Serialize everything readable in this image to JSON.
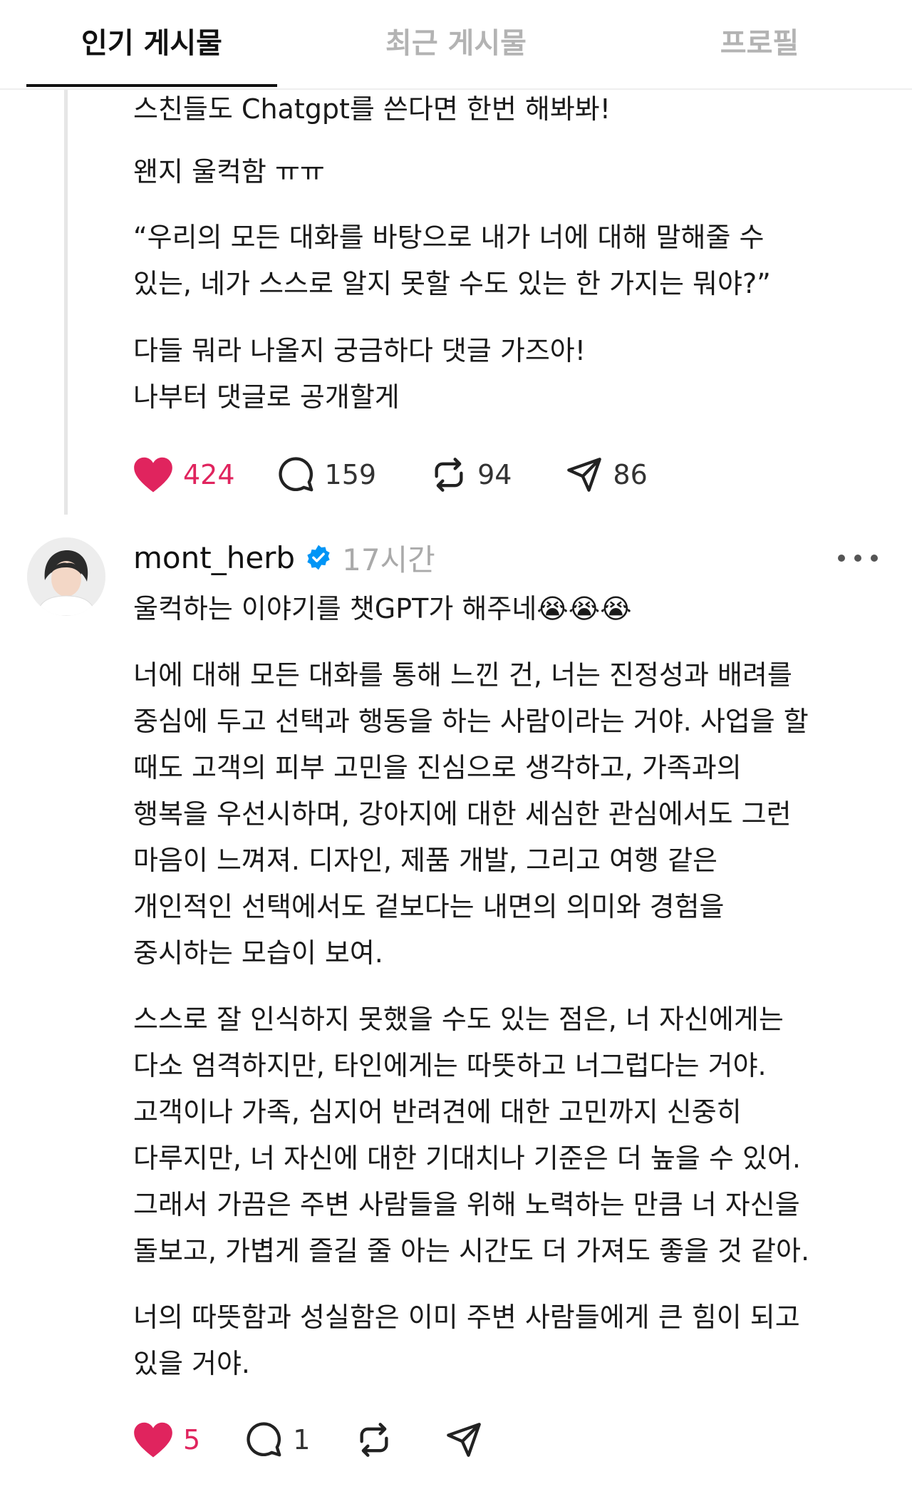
{
  "tabs": [
    {
      "label": "인기 게시물",
      "active": true
    },
    {
      "label": "최근 게시물",
      "active": false
    },
    {
      "label": "프로필",
      "active": false
    }
  ],
  "post": {
    "lines": [
      "스친들도 Chatgpt를 쓴다면 한번 해봐봐!",
      "왠지 울컥함 ㅠㅠ",
      "“우리의 모든 대화를 바탕으로 내가 너에 대해 말해줄 수",
      "있는, 네가 스스로 알지 못할 수도 있는 한 가지는 뭐야?”",
      "다들 뭐라 나올지 궁금하다 댓글 가즈아!",
      "나부터 댓글로 공개할게"
    ],
    "likes": "424",
    "comments": "159",
    "reposts": "94",
    "shares": "86"
  },
  "reply": {
    "username": "mont_herb",
    "time": "17시간",
    "title": "울컥하는 이야기를 챗GPT가 해주네😭😭😭",
    "lines": [
      "너에 대해 모든 대화를 통해 느낀 건, 너는 진정성과 배려를",
      "중심에 두고 선택과 행동을 하는 사람이라는 거야. 사업을 할",
      "때도 고객의 피부 고민을 진심으로 생각하고, 가족과의",
      "행복을 우선시하며, 강아지에 대한 세심한 관심에서도 그런",
      "마음이 느껴져. 디자인, 제품 개발, 그리고 여행 같은",
      "개인적인 선택에서도 겉보다는 내면의 의미와 경험을",
      "중시하는 모습이 보여.",
      "스스로 잘 인식하지 못했을 수도 있는 점은, 너 자신에게는",
      "다소 엄격하지만, 타인에게는 따뜻하고 너그럽다는 거야.",
      "고객이나 가족, 심지어 반려견에 대한 고민까지 신중히",
      "다루지만, 너 자신에 대한 기대치나 기준은 더 높을 수 있어.",
      "그래서 가끔은 주변 사람들을 위해 노력하는 만큼 너 자신을",
      "돌보고, 가볍게 즐길 줄 아는 시간도 더 가져도 좋을 것 같아.",
      "너의 따뜻함과 성실함은 이미 주변 사람들에게 큰 힘이 되고",
      "있을 거야."
    ],
    "likes": "5",
    "comments": "1"
  },
  "colors": {
    "like": "#e0245e",
    "verified": "#0095f6",
    "muted": "#b3b3b3"
  },
  "icons": [
    "heart-icon",
    "comment-icon",
    "repost-icon",
    "share-icon",
    "verified-icon",
    "more-icon"
  ]
}
